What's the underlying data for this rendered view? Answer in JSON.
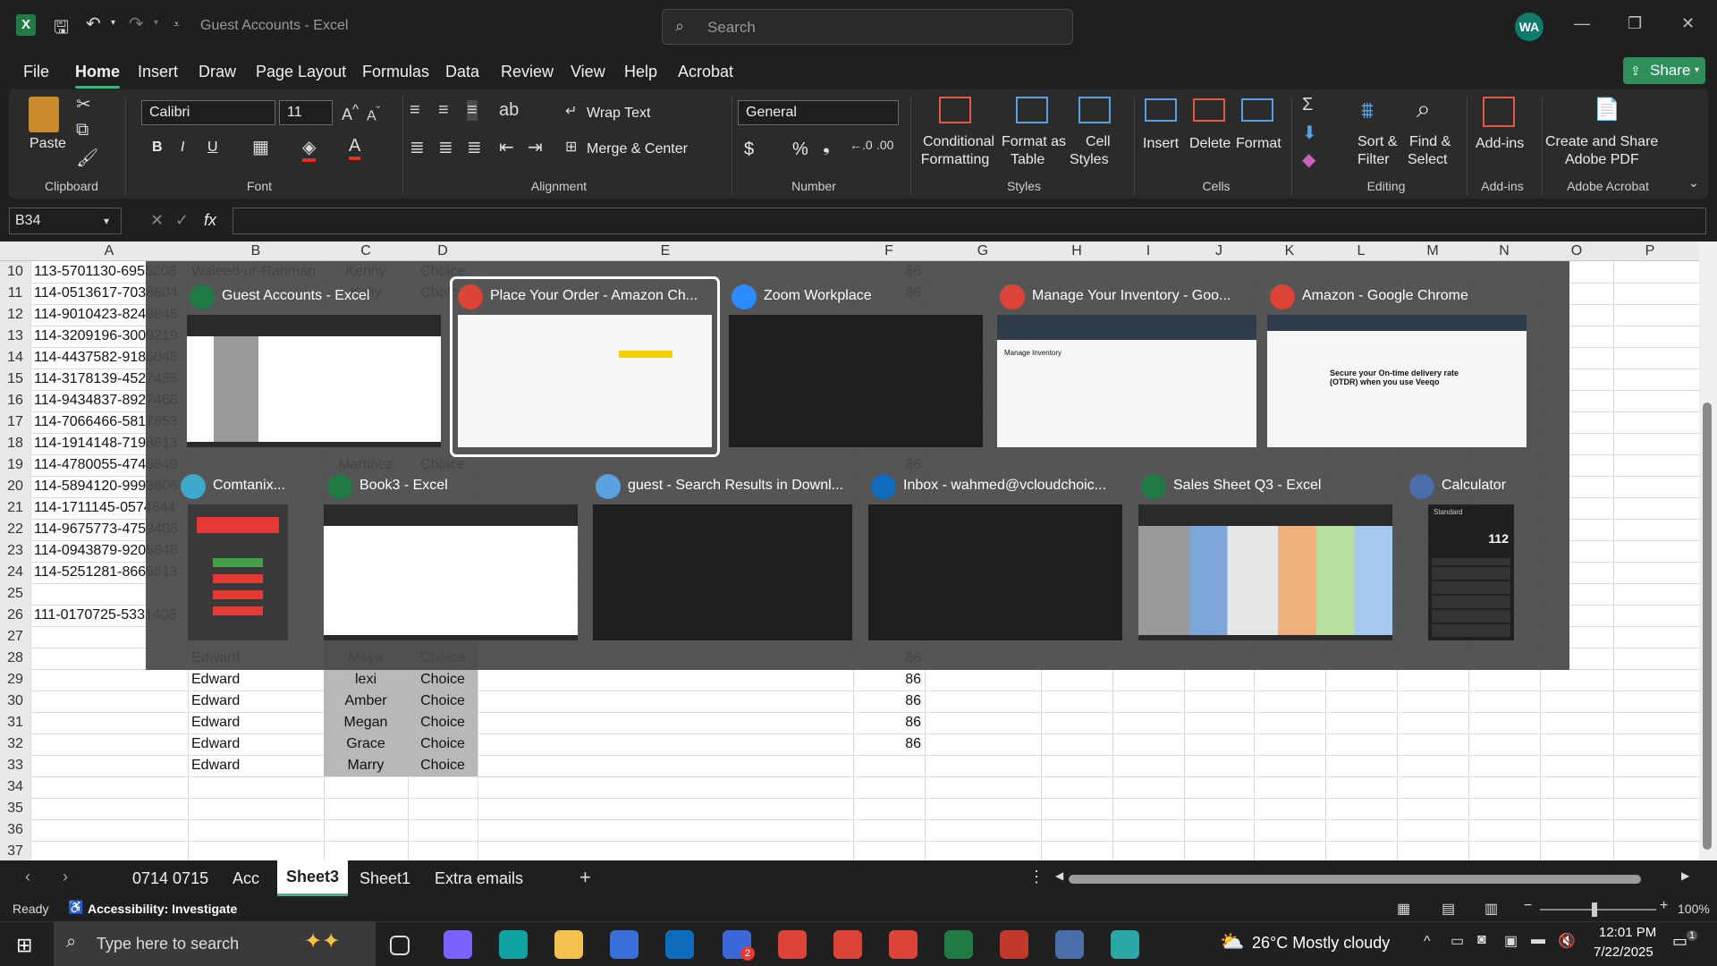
{
  "titlebar": {
    "doc_title": "Guest Accounts  -  Excel",
    "search_placeholder": "Search",
    "user_initials": "WA"
  },
  "menu": [
    "File",
    "Home",
    "Insert",
    "Draw",
    "Page Layout",
    "Formulas",
    "Data",
    "Review",
    "View",
    "Help",
    "Acrobat"
  ],
  "share_label": "Share",
  "ribbon": {
    "paste": "Paste",
    "font_name": "Calibri",
    "font_size": "11",
    "wrap_text": "Wrap Text",
    "merge_center": "Merge & Center",
    "number_format": "General",
    "cond_fmt_1": "Conditional",
    "cond_fmt_2": "Formatting",
    "format_table_1": "Format as",
    "format_table_2": "Table",
    "cell_styles_1": "Cell",
    "cell_styles_2": "Styles",
    "insert": "Insert",
    "delete": "Delete",
    "format": "Format",
    "sort_filter_1": "Sort &",
    "sort_filter_2": "Filter",
    "find_select_1": "Find &",
    "find_select_2": "Select",
    "add_ins": "Add-ins",
    "create_pdf_1": "Create and Share",
    "create_pdf_2": "Adobe PDF",
    "groups": [
      "Clipboard",
      "Font",
      "Alignment",
      "Number",
      "Styles",
      "Cells",
      "Editing",
      "Add-ins",
      "Adobe Acrobat"
    ],
    "bold": "B",
    "italic": "I",
    "underline": "U",
    "percent": "%",
    "dollar": "$",
    "fx": "fx"
  },
  "namebox": "B34",
  "columns": [
    "A",
    "B",
    "C",
    "D",
    "E",
    "F",
    "G",
    "H",
    "I",
    "J",
    "K",
    "L",
    "M",
    "N",
    "O",
    "P"
  ],
  "rows": [
    {
      "n": "10",
      "a": "113-5701130-6955208",
      "b": "Waleed-ur-Rahman",
      "c": "Kenny",
      "d": "Choice",
      "f": "86"
    },
    {
      "n": "11",
      "a": "114-0513617-7038604",
      "b": "",
      "c": "Kelly",
      "d": "Choice",
      "f": "86"
    },
    {
      "n": "12",
      "a": "114-9010423-8249845",
      "b": "",
      "c": "",
      "d": "",
      "f": ""
    },
    {
      "n": "13",
      "a": "114-3209196-3009219",
      "b": "",
      "c": "",
      "d": "",
      "f": ""
    },
    {
      "n": "14",
      "a": "114-4437582-9185045",
      "b": "",
      "c": "",
      "d": "",
      "f": ""
    },
    {
      "n": "15",
      "a": "114-3178139-4527435",
      "b": "",
      "c": "",
      "d": "",
      "f": ""
    },
    {
      "n": "16",
      "a": "114-9434837-8927468",
      "b": "",
      "c": "",
      "d": "",
      "f": ""
    },
    {
      "n": "17",
      "a": "114-7066466-5817853",
      "b": "",
      "c": "",
      "d": "",
      "f": ""
    },
    {
      "n": "18",
      "a": "114-1914148-7198613",
      "b": "",
      "c": "",
      "d": "",
      "f": ""
    },
    {
      "n": "19",
      "a": "114-4780055-4745849",
      "b": "",
      "c": "Martinez",
      "d": "Choice",
      "f": "86"
    },
    {
      "n": "20",
      "a": "114-5894120-9993806",
      "b": "",
      "c": "",
      "d": "",
      "f": ""
    },
    {
      "n": "21",
      "a": "114-1711145-0574644",
      "b": "",
      "c": "",
      "d": "",
      "f": ""
    },
    {
      "n": "22",
      "a": "114-9675773-4759408",
      "b": "",
      "c": "",
      "d": "",
      "f": ""
    },
    {
      "n": "23",
      "a": "114-0943879-9205648",
      "b": "",
      "c": "",
      "d": "",
      "f": ""
    },
    {
      "n": "24",
      "a": "114-5251281-8665813",
      "b": "",
      "c": "",
      "d": "",
      "f": ""
    },
    {
      "n": "25",
      "a": "",
      "b": "",
      "c": "",
      "d": "",
      "f": ""
    },
    {
      "n": "26",
      "a": "111-0170725-5331408",
      "b": "",
      "c": "",
      "d": "",
      "f": ""
    },
    {
      "n": "27",
      "a": "",
      "b": "",
      "c": "",
      "d": "",
      "f": ""
    },
    {
      "n": "28",
      "a": "",
      "b": "Edward",
      "c": "Maya",
      "d": "Choice",
      "f": "86"
    },
    {
      "n": "29",
      "a": "",
      "b": "Edward",
      "c": "lexi",
      "d": "Choice",
      "f": "86"
    },
    {
      "n": "30",
      "a": "",
      "b": "Edward",
      "c": "Amber",
      "d": "Choice",
      "f": "86"
    },
    {
      "n": "31",
      "a": "",
      "b": "Edward",
      "c": "Megan",
      "d": "Choice",
      "f": "86"
    },
    {
      "n": "32",
      "a": "",
      "b": "Edward",
      "c": "Grace",
      "d": "Choice",
      "f": "86"
    },
    {
      "n": "33",
      "a": "",
      "b": "Edward",
      "c": "Marry",
      "d": "Choice",
      "f": ""
    },
    {
      "n": "34",
      "a": "",
      "b": "",
      "c": "",
      "d": "",
      "f": ""
    },
    {
      "n": "35",
      "a": "",
      "b": "",
      "c": "",
      "d": "",
      "f": ""
    },
    {
      "n": "36",
      "a": "",
      "b": "",
      "c": "",
      "d": "",
      "f": ""
    },
    {
      "n": "37",
      "a": "",
      "b": "",
      "c": "",
      "d": "",
      "f": ""
    }
  ],
  "windows": [
    {
      "title": "Guest Accounts - Excel",
      "app": "excel"
    },
    {
      "title": "Place Your Order - Amazon Ch...",
      "app": "chrome"
    },
    {
      "title": "Zoom Workplace",
      "app": "zoom"
    },
    {
      "title": "Manage Your Inventory - Goo...",
      "app": "chrome"
    },
    {
      "title": "Amazon - Google Chrome",
      "app": "chrome"
    },
    {
      "title": "Comtanix...",
      "app": "comtanix"
    },
    {
      "title": "Book3 - Excel",
      "app": "excel"
    },
    {
      "title": "guest - Search Results in Downl...",
      "app": "explorer"
    },
    {
      "title": "Inbox - wahmed@vcloudchoic...",
      "app": "outlook"
    },
    {
      "title": "Sales Sheet Q3 - Excel",
      "app": "excel"
    },
    {
      "title": "Calculator",
      "app": "calculator"
    }
  ],
  "thumb_texts": {
    "calc_value": "112",
    "calc_mode": "Standard",
    "amazon_banner": "Secure your On-time delivery rate (OTDR) when you use Veeqo",
    "inventory_heading": "Manage Inventory"
  },
  "sheet_tabs": [
    "0714 0715",
    "Acc",
    "Sheet3",
    "Sheet1",
    "Extra emails"
  ],
  "active_tab": "Sheet3",
  "status": {
    "ready": "Ready",
    "accessibility": "Accessibility: Investigate",
    "zoom": "100%"
  },
  "taskbar": {
    "search_placeholder": "Type here to search",
    "weather": "26°C  Mostly cloudy",
    "time": "12:01 PM",
    "date": "7/22/2025",
    "notif_count": "1",
    "teams_badge": "2"
  },
  "colors": {
    "excel_green": "#1f7a43",
    "accent": "#3fb27f",
    "chrome_red": "#db4437"
  }
}
